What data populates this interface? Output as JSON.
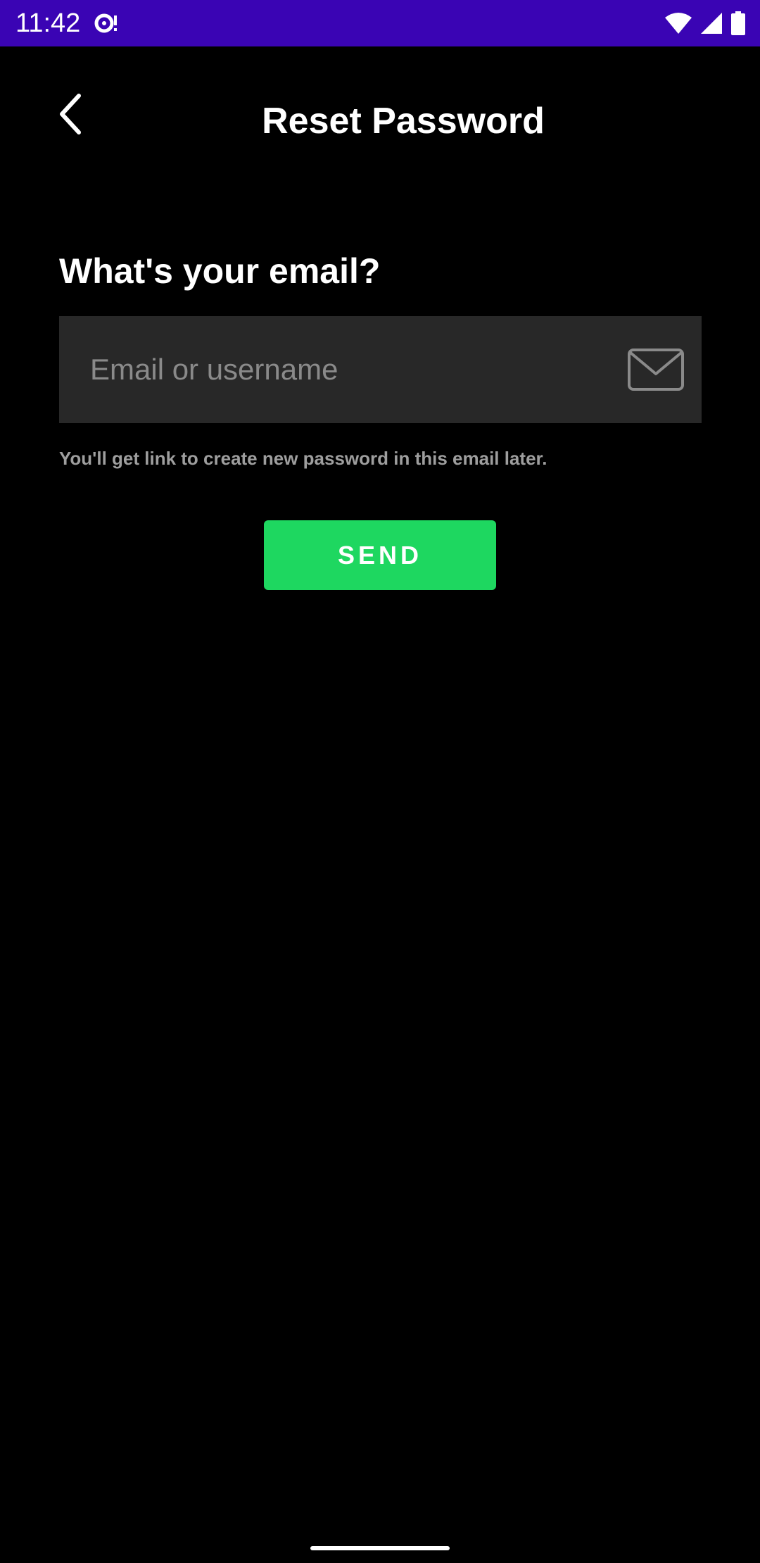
{
  "status_bar": {
    "time": "11:42",
    "background": "#3a04b4",
    "icons": [
      "media-sync-icon",
      "wifi-icon",
      "cell-signal-icon",
      "battery-icon"
    ]
  },
  "app_bar": {
    "back_icon": "chevron-left-icon",
    "title": "Reset Password"
  },
  "form": {
    "question": "What's your email?",
    "email_input": {
      "value": "",
      "placeholder": "Email or username",
      "icon": "mail-icon"
    },
    "helper_text": "You'll get link to create new password in this email later.",
    "send_label": "SEND"
  },
  "colors": {
    "background": "#000000",
    "input_background": "#282828",
    "accent": "#1ed760",
    "helper_text": "#9e9e9e"
  }
}
